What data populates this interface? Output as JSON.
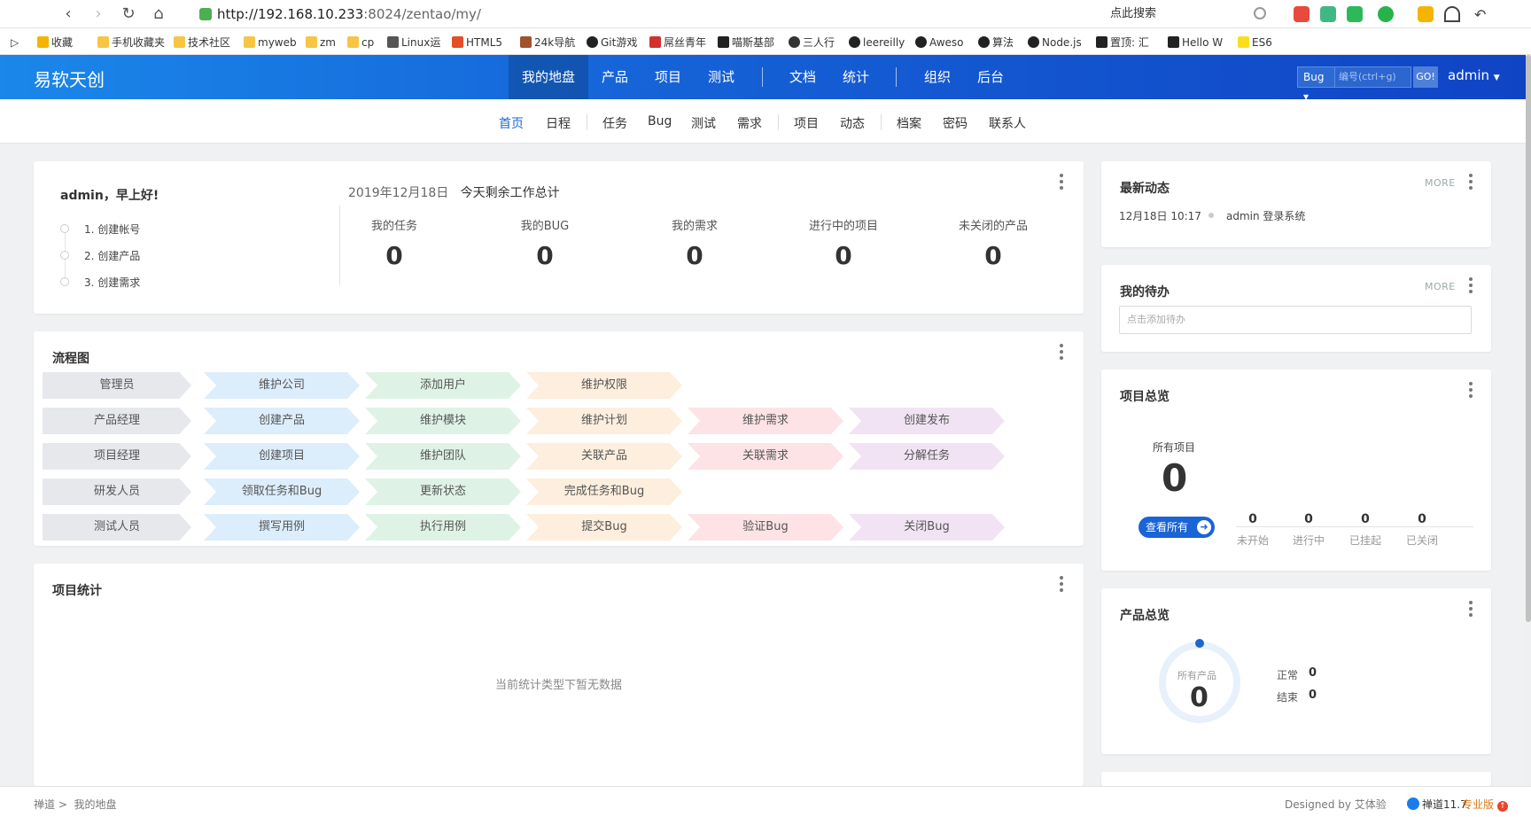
{
  "browser": {
    "url_host": "http://192.168.10.233",
    "url_rest": ":8024/zentao/my/",
    "search_placeholder": "点此搜索",
    "bookmarks": [
      "收藏",
      "手机收藏夹",
      "技术社区",
      "myweb",
      "zm",
      "cp",
      "Linux运",
      "HTML5",
      "24k导航",
      "Git游戏",
      "屌丝青年",
      "喵斯基部",
      "三人行",
      "leereilly",
      "Aweso",
      "算法",
      "Node.js",
      "置顶: 汇",
      "Hello W",
      "ES6"
    ]
  },
  "topnav": {
    "brand": "易软天创",
    "items": [
      "我的地盘",
      "产品",
      "项目",
      "测试",
      "文档",
      "统计",
      "组织",
      "后台"
    ],
    "search_type": "Bug",
    "search_placeholder": "编号(ctrl+g)",
    "go": "GO!",
    "user": "admin"
  },
  "subnav": {
    "items": [
      "首页",
      "日程",
      "任务",
      "Bug",
      "测试",
      "需求",
      "项目",
      "动态",
      "档案",
      "密码",
      "联系人"
    ]
  },
  "welcome": {
    "greeting": "admin，早上好!",
    "steps": [
      "1. 创建帐号",
      "2. 创建产品",
      "3. 创建需求"
    ],
    "date": "2019年12月18日",
    "date_suffix": "今天剩余工作总计",
    "stats": [
      {
        "label": "我的任务",
        "value": "0"
      },
      {
        "label": "我的BUG",
        "value": "0"
      },
      {
        "label": "我的需求",
        "value": "0"
      },
      {
        "label": "进行中的项目",
        "value": "0"
      },
      {
        "label": "未关闭的产品",
        "value": "0"
      }
    ]
  },
  "flow": {
    "title": "流程图",
    "rows": [
      [
        "管理员",
        "维护公司",
        "添加用户",
        "维护权限"
      ],
      [
        "产品经理",
        "创建产品",
        "维护模块",
        "维护计划",
        "维护需求",
        "创建发布"
      ],
      [
        "项目经理",
        "创建项目",
        "维护团队",
        "关联产品",
        "关联需求",
        "分解任务"
      ],
      [
        "研发人员",
        "领取任务和Bug",
        "更新状态",
        "完成任务和Bug"
      ],
      [
        "测试人员",
        "撰写用例",
        "执行用例",
        "提交Bug",
        "验证Bug",
        "关闭Bug"
      ]
    ]
  },
  "project_stats": {
    "title": "项目统计",
    "empty": "当前统计类型下暂无数据"
  },
  "activity": {
    "title": "最新动态",
    "more": "MORE",
    "time": "12月18日 10:17",
    "text": "admin 登录系统"
  },
  "todo": {
    "title": "我的待办",
    "more": "MORE",
    "placeholder": "点击添加待办"
  },
  "project_overview": {
    "title": "项目总览",
    "label": "所有项目",
    "value": "0",
    "button": "查看所有",
    "stats": [
      {
        "value": "0",
        "label": "未开始"
      },
      {
        "value": "0",
        "label": "进行中"
      },
      {
        "value": "0",
        "label": "已挂起"
      },
      {
        "value": "0",
        "label": "已关闭"
      }
    ]
  },
  "product_overview": {
    "title": "产品总览",
    "label": "所有产品",
    "value": "0",
    "legend": [
      {
        "label": "正常",
        "value": "0"
      },
      {
        "label": "结束",
        "value": "0"
      }
    ]
  },
  "footer": {
    "crumb1": "禅道",
    "crumb2": "我的地盘",
    "designed": "Designed by 艾体验",
    "version": "禅道11.7",
    "edition": "专业版"
  },
  "colors": {
    "nav_start": "#1a87ea",
    "nav_end": "#1044c5",
    "accent": "#1a64d6"
  }
}
